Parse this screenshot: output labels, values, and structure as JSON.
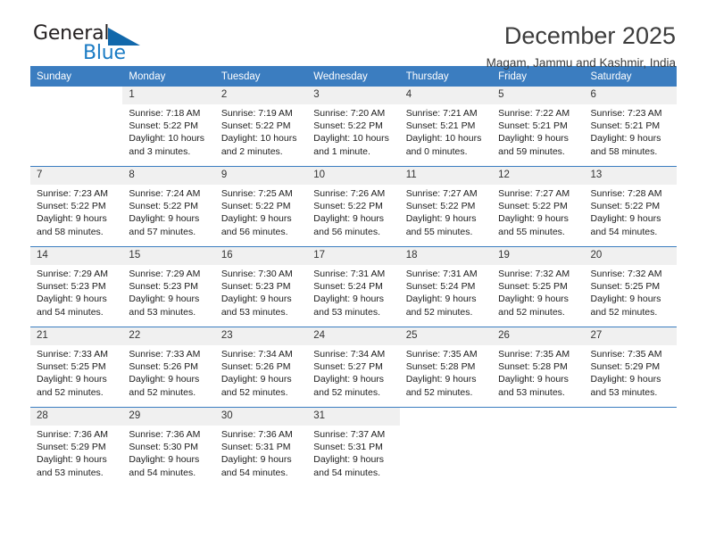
{
  "logo": {
    "text_primary": "General",
    "text_secondary": "Blue",
    "triangle_icon": "blue-triangle-icon",
    "primary_color": "#231f20",
    "secondary_color": "#1a7bc4"
  },
  "header": {
    "title": "December 2025",
    "subtitle": "Magam, Jammu and Kashmir, India"
  },
  "theme": {
    "header_bg": "#3b7dc0",
    "header_text": "#ffffff",
    "daynum_bg": "#f0f0f0",
    "grid_line": "#3b7dc0"
  },
  "calendar": {
    "weekday_headers": [
      "Sunday",
      "Monday",
      "Tuesday",
      "Wednesday",
      "Thursday",
      "Friday",
      "Saturday"
    ],
    "weeks": [
      [
        {
          "day": "",
          "sunrise": "",
          "sunset": "",
          "daylight": ""
        },
        {
          "day": "1",
          "sunrise": "Sunrise: 7:18 AM",
          "sunset": "Sunset: 5:22 PM",
          "daylight": "Daylight: 10 hours and 3 minutes."
        },
        {
          "day": "2",
          "sunrise": "Sunrise: 7:19 AM",
          "sunset": "Sunset: 5:22 PM",
          "daylight": "Daylight: 10 hours and 2 minutes."
        },
        {
          "day": "3",
          "sunrise": "Sunrise: 7:20 AM",
          "sunset": "Sunset: 5:22 PM",
          "daylight": "Daylight: 10 hours and 1 minute."
        },
        {
          "day": "4",
          "sunrise": "Sunrise: 7:21 AM",
          "sunset": "Sunset: 5:21 PM",
          "daylight": "Daylight: 10 hours and 0 minutes."
        },
        {
          "day": "5",
          "sunrise": "Sunrise: 7:22 AM",
          "sunset": "Sunset: 5:21 PM",
          "daylight": "Daylight: 9 hours and 59 minutes."
        },
        {
          "day": "6",
          "sunrise": "Sunrise: 7:23 AM",
          "sunset": "Sunset: 5:21 PM",
          "daylight": "Daylight: 9 hours and 58 minutes."
        }
      ],
      [
        {
          "day": "7",
          "sunrise": "Sunrise: 7:23 AM",
          "sunset": "Sunset: 5:22 PM",
          "daylight": "Daylight: 9 hours and 58 minutes."
        },
        {
          "day": "8",
          "sunrise": "Sunrise: 7:24 AM",
          "sunset": "Sunset: 5:22 PM",
          "daylight": "Daylight: 9 hours and 57 minutes."
        },
        {
          "day": "9",
          "sunrise": "Sunrise: 7:25 AM",
          "sunset": "Sunset: 5:22 PM",
          "daylight": "Daylight: 9 hours and 56 minutes."
        },
        {
          "day": "10",
          "sunrise": "Sunrise: 7:26 AM",
          "sunset": "Sunset: 5:22 PM",
          "daylight": "Daylight: 9 hours and 56 minutes."
        },
        {
          "day": "11",
          "sunrise": "Sunrise: 7:27 AM",
          "sunset": "Sunset: 5:22 PM",
          "daylight": "Daylight: 9 hours and 55 minutes."
        },
        {
          "day": "12",
          "sunrise": "Sunrise: 7:27 AM",
          "sunset": "Sunset: 5:22 PM",
          "daylight": "Daylight: 9 hours and 55 minutes."
        },
        {
          "day": "13",
          "sunrise": "Sunrise: 7:28 AM",
          "sunset": "Sunset: 5:22 PM",
          "daylight": "Daylight: 9 hours and 54 minutes."
        }
      ],
      [
        {
          "day": "14",
          "sunrise": "Sunrise: 7:29 AM",
          "sunset": "Sunset: 5:23 PM",
          "daylight": "Daylight: 9 hours and 54 minutes."
        },
        {
          "day": "15",
          "sunrise": "Sunrise: 7:29 AM",
          "sunset": "Sunset: 5:23 PM",
          "daylight": "Daylight: 9 hours and 53 minutes."
        },
        {
          "day": "16",
          "sunrise": "Sunrise: 7:30 AM",
          "sunset": "Sunset: 5:23 PM",
          "daylight": "Daylight: 9 hours and 53 minutes."
        },
        {
          "day": "17",
          "sunrise": "Sunrise: 7:31 AM",
          "sunset": "Sunset: 5:24 PM",
          "daylight": "Daylight: 9 hours and 53 minutes."
        },
        {
          "day": "18",
          "sunrise": "Sunrise: 7:31 AM",
          "sunset": "Sunset: 5:24 PM",
          "daylight": "Daylight: 9 hours and 52 minutes."
        },
        {
          "day": "19",
          "sunrise": "Sunrise: 7:32 AM",
          "sunset": "Sunset: 5:25 PM",
          "daylight": "Daylight: 9 hours and 52 minutes."
        },
        {
          "day": "20",
          "sunrise": "Sunrise: 7:32 AM",
          "sunset": "Sunset: 5:25 PM",
          "daylight": "Daylight: 9 hours and 52 minutes."
        }
      ],
      [
        {
          "day": "21",
          "sunrise": "Sunrise: 7:33 AM",
          "sunset": "Sunset: 5:25 PM",
          "daylight": "Daylight: 9 hours and 52 minutes."
        },
        {
          "day": "22",
          "sunrise": "Sunrise: 7:33 AM",
          "sunset": "Sunset: 5:26 PM",
          "daylight": "Daylight: 9 hours and 52 minutes."
        },
        {
          "day": "23",
          "sunrise": "Sunrise: 7:34 AM",
          "sunset": "Sunset: 5:26 PM",
          "daylight": "Daylight: 9 hours and 52 minutes."
        },
        {
          "day": "24",
          "sunrise": "Sunrise: 7:34 AM",
          "sunset": "Sunset: 5:27 PM",
          "daylight": "Daylight: 9 hours and 52 minutes."
        },
        {
          "day": "25",
          "sunrise": "Sunrise: 7:35 AM",
          "sunset": "Sunset: 5:28 PM",
          "daylight": "Daylight: 9 hours and 52 minutes."
        },
        {
          "day": "26",
          "sunrise": "Sunrise: 7:35 AM",
          "sunset": "Sunset: 5:28 PM",
          "daylight": "Daylight: 9 hours and 53 minutes."
        },
        {
          "day": "27",
          "sunrise": "Sunrise: 7:35 AM",
          "sunset": "Sunset: 5:29 PM",
          "daylight": "Daylight: 9 hours and 53 minutes."
        }
      ],
      [
        {
          "day": "28",
          "sunrise": "Sunrise: 7:36 AM",
          "sunset": "Sunset: 5:29 PM",
          "daylight": "Daylight: 9 hours and 53 minutes."
        },
        {
          "day": "29",
          "sunrise": "Sunrise: 7:36 AM",
          "sunset": "Sunset: 5:30 PM",
          "daylight": "Daylight: 9 hours and 54 minutes."
        },
        {
          "day": "30",
          "sunrise": "Sunrise: 7:36 AM",
          "sunset": "Sunset: 5:31 PM",
          "daylight": "Daylight: 9 hours and 54 minutes."
        },
        {
          "day": "31",
          "sunrise": "Sunrise: 7:37 AM",
          "sunset": "Sunset: 5:31 PM",
          "daylight": "Daylight: 9 hours and 54 minutes."
        },
        {
          "day": "",
          "sunrise": "",
          "sunset": "",
          "daylight": ""
        },
        {
          "day": "",
          "sunrise": "",
          "sunset": "",
          "daylight": ""
        },
        {
          "day": "",
          "sunrise": "",
          "sunset": "",
          "daylight": ""
        }
      ]
    ]
  }
}
